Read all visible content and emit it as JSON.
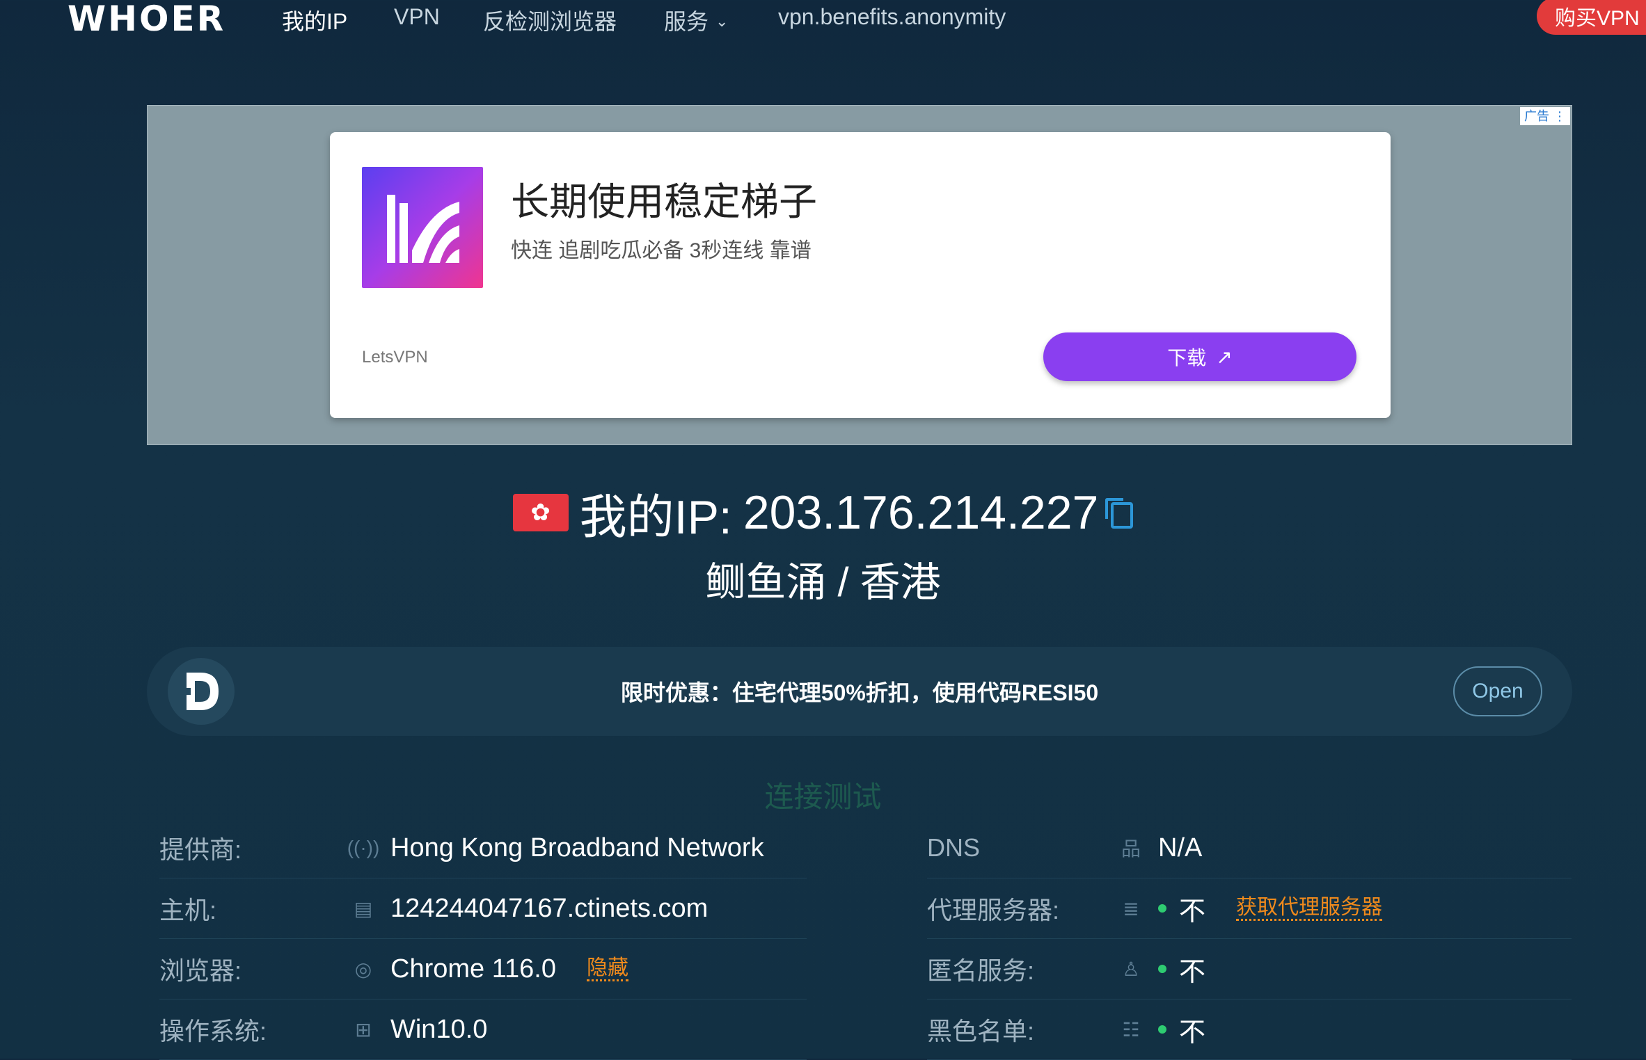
{
  "nav": {
    "logo": "WHOER",
    "items": [
      {
        "label": "我的IP"
      },
      {
        "label": "VPN"
      },
      {
        "label": "反检测浏览器"
      },
      {
        "label": "服务"
      },
      {
        "label": "vpn.benefits.anonymity"
      }
    ],
    "buy_button": "购买VPN"
  },
  "ad": {
    "badge": "广告",
    "badge_menu": "⋮",
    "title": "长期使用稳定梯子",
    "subtitle": "快连 追剧吃瓜必备 3秒连线 靠谱",
    "brand": "LetsVPN",
    "button": "下载",
    "button_icon": "↗"
  },
  "ip": {
    "prefix": "我的IP:",
    "address": "203.176.214.227",
    "location": "鲗鱼涌 / 香港",
    "flag": "hong-kong-flag"
  },
  "promo": {
    "text": "限时优惠：住宅代理50%折扣，使用代码RESI50",
    "button": "Open"
  },
  "section_title": "连接测试",
  "left_rows": [
    {
      "label": "提供商:",
      "icon": "signal-icon",
      "value": "Hong Kong Broadband Network"
    },
    {
      "label": "主机:",
      "icon": "server-icon",
      "value": "124244047167.ctinets.com"
    },
    {
      "label": "浏览器:",
      "icon": "browser-icon",
      "value": "Chrome 116.0",
      "link": "隐藏"
    },
    {
      "label": "操作系统:",
      "icon": "windows-icon",
      "value": "Win10.0"
    }
  ],
  "right_rows": [
    {
      "label": "DNS",
      "icon": "network-icon",
      "value": "N/A"
    },
    {
      "label": "代理服务器:",
      "icon": "database-icon",
      "value": "不",
      "link": "获取代理服务器"
    },
    {
      "label": "匿名服务:",
      "icon": "anonymous-icon",
      "value": "不"
    },
    {
      "label": "黑色名单:",
      "icon": "blacklist-icon",
      "value": "不"
    }
  ],
  "colors": {
    "background": "#143246",
    "accent_red": "#e23b3b",
    "ad_button": "#8a3ff0",
    "status_green": "#2ecc71",
    "link_orange": "#f08a1c"
  }
}
